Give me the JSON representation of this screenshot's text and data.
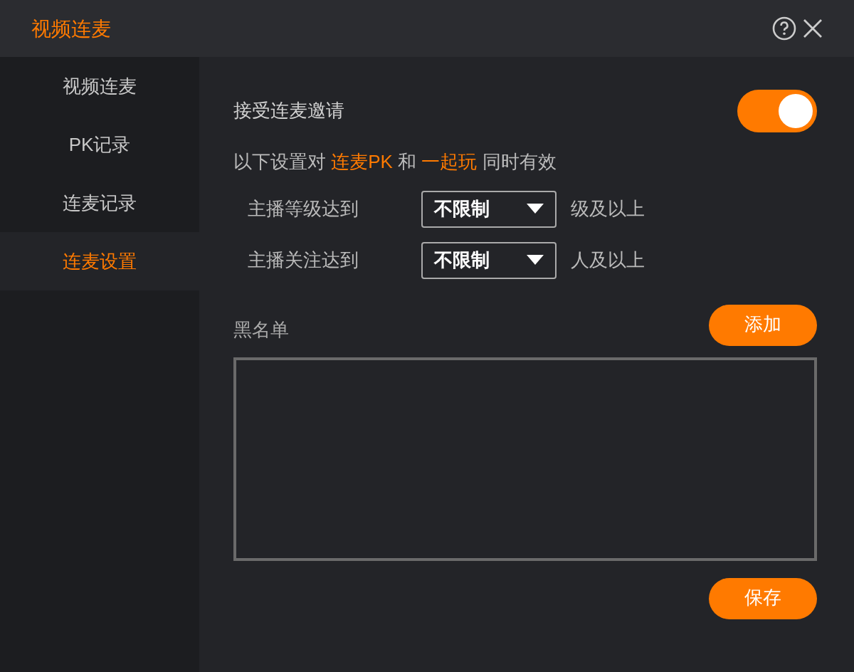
{
  "window": {
    "title": "视频连麦"
  },
  "sidebar": {
    "items": [
      {
        "label": "视频连麦",
        "selected": false
      },
      {
        "label": "PK记录",
        "selected": false
      },
      {
        "label": "连麦记录",
        "selected": false
      },
      {
        "label": "连麦设置",
        "selected": true
      }
    ]
  },
  "accept_invite": {
    "label": "接受连麦邀请",
    "on": true
  },
  "note": [
    {
      "text": "以下设置对 ",
      "highlight": false
    },
    {
      "text": "连麦PK",
      "highlight": true
    },
    {
      "text": " 和 ",
      "highlight": false
    },
    {
      "text": "一起玩",
      "highlight": true
    },
    {
      "text": " 同时有效",
      "highlight": false
    }
  ],
  "rules": [
    {
      "label": "主播等级达到",
      "value": "不限制",
      "suffix": "级及以上"
    },
    {
      "label": "主播关注达到",
      "value": "不限制",
      "suffix": "人及以上"
    }
  ],
  "blacklist": {
    "label": "黑名单",
    "add_button": "添加"
  },
  "save_button": "保存"
}
